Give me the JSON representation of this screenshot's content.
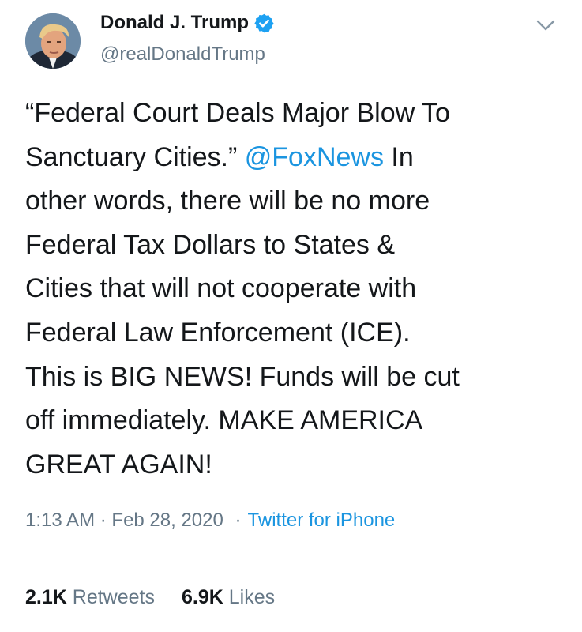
{
  "user": {
    "name": "Donald J. Trump",
    "handle": "@realDonaldTrump",
    "verified": true
  },
  "tweet": {
    "lines": [
      {
        "before": "“Federal Court Deals Major Blow To",
        "mention": "",
        "after": ""
      },
      {
        "before": "Sanctuary Cities.” ",
        "mention": "@FoxNews",
        "after": "  In"
      },
      {
        "before": "other words, there will be no more",
        "mention": "",
        "after": ""
      },
      {
        "before": "Federal Tax Dollars to States &",
        "mention": "",
        "after": ""
      },
      {
        "before": "Cities that will not cooperate with",
        "mention": "",
        "after": ""
      },
      {
        "before": "Federal Law Enforcement (ICE).",
        "mention": "",
        "after": ""
      },
      {
        "before": "This is BIG NEWS! Funds will be cut",
        "mention": "",
        "after": ""
      },
      {
        "before": "off immediately. MAKE AMERICA",
        "mention": "",
        "after": ""
      },
      {
        "before": "GREAT AGAIN!",
        "mention": "",
        "after": ""
      }
    ]
  },
  "meta": {
    "time": "1:13 AM",
    "separator": "·",
    "date": "Feb 28, 2020",
    "source": "Twitter for iPhone"
  },
  "stats": {
    "retweets_count": "2.1K",
    "retweets_label": " Retweets",
    "likes_count": "6.9K",
    "likes_label": " Likes"
  },
  "icons": {
    "verified": "verified-badge-icon",
    "menu": "chevron-down-icon",
    "avatar": "profile-avatar"
  },
  "colors": {
    "text": "#14171a",
    "secondary": "#657786",
    "link": "#1b95e0",
    "verified": "#1da1f2",
    "divider": "#e1e8ed"
  }
}
